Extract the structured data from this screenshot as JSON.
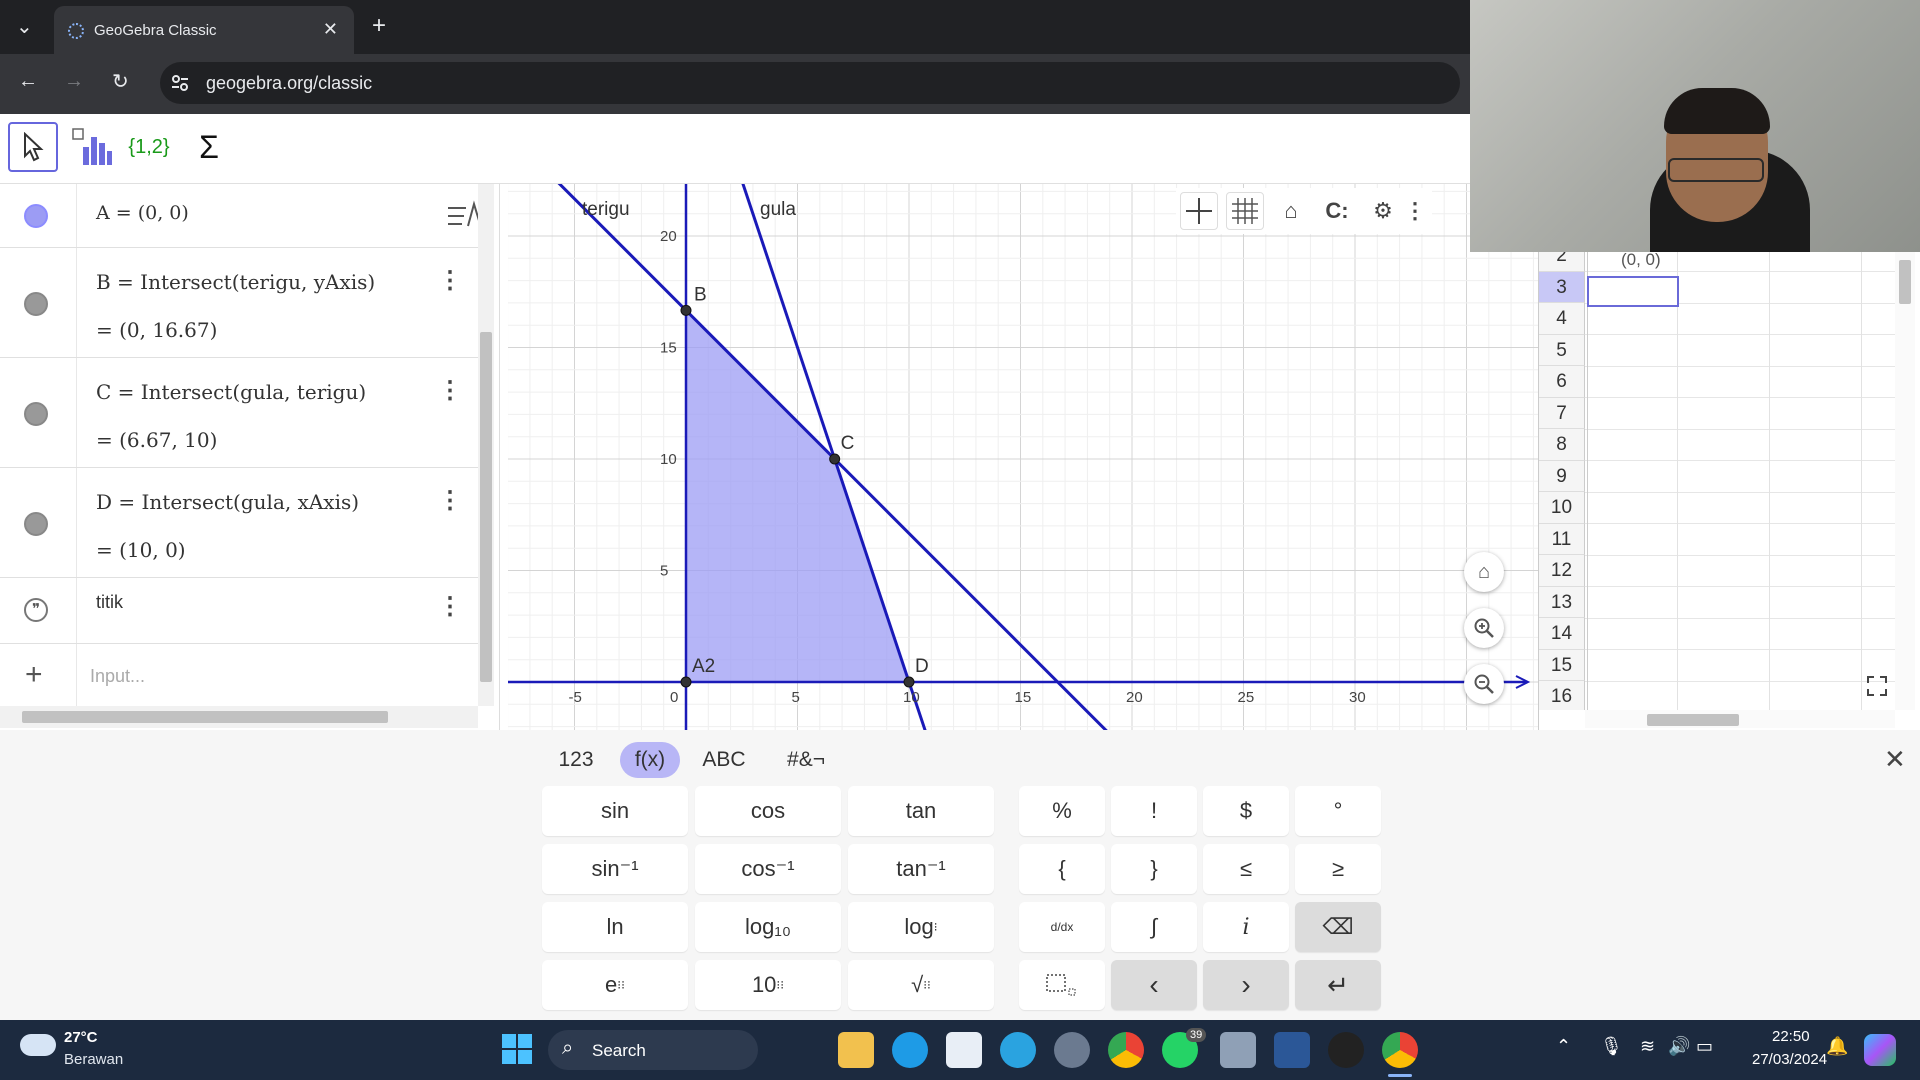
{
  "browser": {
    "tab_title": "GeoGebra Classic",
    "url": "geogebra.org/classic"
  },
  "toolbar": {
    "tools": [
      "move-tool",
      "spreadsheet-tool",
      "list-tool",
      "sum-tool"
    ],
    "list_label": "{1,2}",
    "sum_label": "Σ"
  },
  "algebra": {
    "rows": [
      {
        "def": "A = (0, 0)",
        "value": "",
        "color": "#8c8cff"
      },
      {
        "def": "B = Intersect(terigu, yAxis)",
        "value": "= (0, 16.67)",
        "color": "#808080"
      },
      {
        "def": "C = Intersect(gula, terigu)",
        "value": "= (6.67, 10)",
        "color": "#808080"
      },
      {
        "def": "D = Intersect(gula, xAxis)",
        "value": "= (10, 0)",
        "color": "#808080"
      },
      {
        "def": "titik",
        "value": ""
      }
    ],
    "input_placeholder": "Input..."
  },
  "graphics": {
    "line_labels": [
      "terigu",
      "gula"
    ],
    "point_labels": [
      "B",
      "C",
      "D",
      "A2"
    ],
    "x_ticks": [
      "-5",
      "0",
      "5",
      "10",
      "15",
      "20",
      "25",
      "30"
    ],
    "y_ticks": [
      "20",
      "15",
      "10",
      "5"
    ],
    "line_color": "#1a1ab8",
    "fill_color": "#9c9cf4"
  },
  "spreadsheet": {
    "cell_b2": "(0, 0)",
    "rows": [
      "2",
      "3",
      "4",
      "5",
      "6",
      "7",
      "8",
      "9",
      "10",
      "11",
      "12",
      "13",
      "14",
      "15",
      "16"
    ],
    "selected_row": "3"
  },
  "keyboard": {
    "tabs": [
      "123",
      "f(x)",
      "ABC",
      "#&¬"
    ],
    "active_tab": "f(x)",
    "func_keys": [
      "sin",
      "cos",
      "tan",
      "sin⁻¹",
      "cos⁻¹",
      "tan⁻¹",
      "ln",
      "log₁₀",
      "log",
      "e",
      "10",
      "√"
    ],
    "sym_keys": [
      "%",
      "!",
      "$",
      "°",
      "{",
      "}",
      "≤",
      "≥",
      "d/dx",
      "∫",
      "i",
      "⌫",
      "",
      "‹",
      "›",
      "↵"
    ]
  },
  "taskbar": {
    "weather_temp": "27°C",
    "weather_text": "Berawan",
    "search_label": "Search",
    "badge_count": "39",
    "time": "22:50",
    "date": "27/03/2024"
  }
}
